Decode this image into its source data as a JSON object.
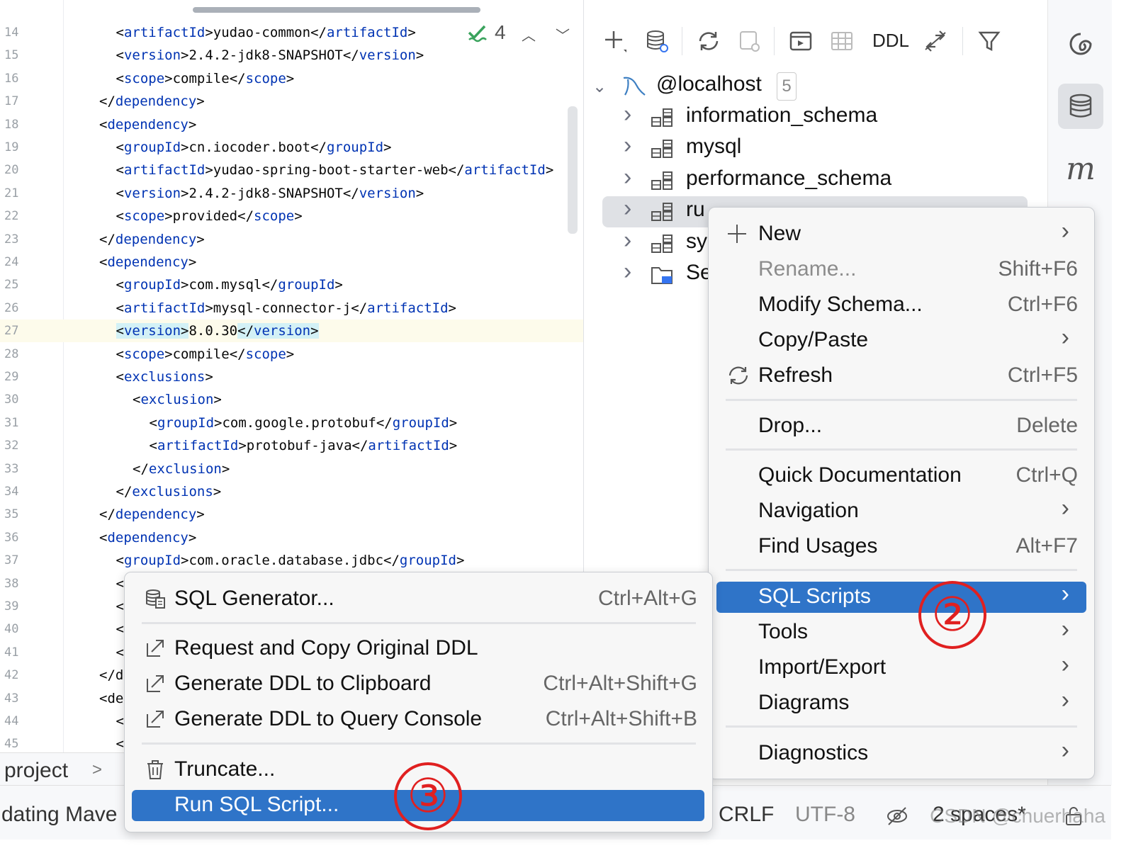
{
  "editor": {
    "inspection_count": "4",
    "lines": [
      {
        "n": "14",
        "indent": 2,
        "open": "artifactId",
        "text": "yudao-common",
        "close": "artifactId"
      },
      {
        "n": "15",
        "indent": 2,
        "open": "version",
        "text": "2.4.2-jdk8-SNAPSHOT",
        "close": "version"
      },
      {
        "n": "16",
        "indent": 2,
        "open": "scope",
        "text": "compile",
        "close": "scope"
      },
      {
        "n": "17",
        "indent": 1,
        "open": "",
        "text": "",
        "close": "dependency"
      },
      {
        "n": "18",
        "indent": 1,
        "open": "dependency",
        "text": "",
        "close": ""
      },
      {
        "n": "19",
        "indent": 2,
        "open": "groupId",
        "text": "cn.iocoder.boot",
        "close": "groupId"
      },
      {
        "n": "20",
        "indent": 2,
        "open": "artifactId",
        "text": "yudao-spring-boot-starter-web",
        "close": "artifactId"
      },
      {
        "n": "21",
        "indent": 2,
        "open": "version",
        "text": "2.4.2-jdk8-SNAPSHOT",
        "close": "version"
      },
      {
        "n": "22",
        "indent": 2,
        "open": "scope",
        "text": "provided",
        "close": "scope"
      },
      {
        "n": "23",
        "indent": 1,
        "open": "",
        "text": "",
        "close": "dependency"
      },
      {
        "n": "24",
        "indent": 1,
        "open": "dependency",
        "text": "",
        "close": ""
      },
      {
        "n": "25",
        "indent": 2,
        "open": "groupId",
        "text": "com.mysql",
        "close": "groupId"
      },
      {
        "n": "26",
        "indent": 2,
        "open": "artifactId",
        "text": "mysql-connector-j",
        "close": "artifactId"
      },
      {
        "n": "27",
        "indent": 2,
        "open": "version",
        "text": "8.0.30",
        "close": "version",
        "highlight": true
      },
      {
        "n": "28",
        "indent": 2,
        "open": "scope",
        "text": "compile",
        "close": "scope"
      },
      {
        "n": "29",
        "indent": 2,
        "open": "exclusions",
        "text": "",
        "close": ""
      },
      {
        "n": "30",
        "indent": 3,
        "open": "exclusion",
        "text": "",
        "close": ""
      },
      {
        "n": "31",
        "indent": 4,
        "open": "groupId",
        "text": "com.google.protobuf",
        "close": "groupId"
      },
      {
        "n": "32",
        "indent": 4,
        "open": "artifactId",
        "text": "protobuf-java",
        "close": "artifactId"
      },
      {
        "n": "33",
        "indent": 3,
        "open": "",
        "text": "",
        "close": "exclusion"
      },
      {
        "n": "34",
        "indent": 2,
        "open": "",
        "text": "",
        "close": "exclusions"
      },
      {
        "n": "35",
        "indent": 1,
        "open": "",
        "text": "",
        "close": "dependency"
      },
      {
        "n": "36",
        "indent": 1,
        "open": "dependency",
        "text": "",
        "close": ""
      },
      {
        "n": "37",
        "indent": 2,
        "open": "groupId",
        "text": "com.oracle.database.jdbc",
        "close": "groupId"
      },
      {
        "n": "38",
        "indent": 2,
        "raw": "<"
      },
      {
        "n": "39",
        "indent": 2,
        "raw": "<"
      },
      {
        "n": "40",
        "indent": 2,
        "raw": "<"
      },
      {
        "n": "41",
        "indent": 2,
        "raw": "<"
      },
      {
        "n": "42",
        "indent": 1,
        "raw": "</d"
      },
      {
        "n": "43",
        "indent": 1,
        "raw": "<de"
      },
      {
        "n": "44",
        "indent": 2,
        "raw": "<"
      },
      {
        "n": "45",
        "indent": 2,
        "raw": "<"
      }
    ]
  },
  "db_toolbar": {
    "ddl_label": "DDL"
  },
  "tree": {
    "root": {
      "label": "@localhost",
      "count": "5"
    },
    "items": [
      {
        "label": "information_schema"
      },
      {
        "label": "mysql"
      },
      {
        "label": "performance_schema"
      },
      {
        "label": "ru"
      },
      {
        "label": "sy"
      },
      {
        "label": "Se"
      }
    ]
  },
  "context_menu": {
    "items": [
      {
        "label": "New",
        "shortcut": "",
        "submenu": true
      },
      {
        "label": "Rename...",
        "shortcut": "Shift+F6",
        "disabled": true
      },
      {
        "label": "Modify Schema...",
        "shortcut": "Ctrl+F6"
      },
      {
        "label": "Copy/Paste",
        "shortcut": "",
        "submenu": true
      },
      {
        "label": "Refresh",
        "shortcut": "Ctrl+F5"
      },
      {
        "label": "Drop...",
        "shortcut": "Delete"
      },
      {
        "label": "Quick Documentation",
        "shortcut": "Ctrl+Q"
      },
      {
        "label": "Navigation",
        "shortcut": "",
        "submenu": true
      },
      {
        "label": "Find Usages",
        "shortcut": "Alt+F7"
      },
      {
        "label": "SQL Scripts",
        "shortcut": "",
        "submenu": true,
        "active": true
      },
      {
        "label": "Tools",
        "shortcut": "",
        "submenu": true
      },
      {
        "label": "Import/Export",
        "shortcut": "",
        "submenu": true
      },
      {
        "label": "Diagrams",
        "shortcut": "",
        "submenu": true
      },
      {
        "label": "Diagnostics",
        "shortcut": "",
        "submenu": true
      }
    ]
  },
  "sql_scripts_menu": {
    "items": [
      {
        "label": "SQL Generator...",
        "shortcut": "Ctrl+Alt+G"
      },
      {
        "label": "Request and Copy Original DDL",
        "shortcut": ""
      },
      {
        "label": "Generate DDL to Clipboard",
        "shortcut": "Ctrl+Alt+Shift+G"
      },
      {
        "label": "Generate DDL to Query Console",
        "shortcut": "Ctrl+Alt+Shift+B"
      },
      {
        "label": "Truncate...",
        "shortcut": ""
      },
      {
        "label": "Run SQL Script...",
        "shortcut": "",
        "active": true
      }
    ]
  },
  "annotations": {
    "step2": "②",
    "step3": "③"
  },
  "statusbar": {
    "project_label": "project",
    "task_text": "dating Mave",
    "line_sep": "CRLF",
    "encoding": "UTF-8",
    "indent": "2 spaces*"
  },
  "watermark": "CSDN @chuerhaha",
  "colors": {
    "accent": "#2f74c8",
    "tag": "#0033b3",
    "annotation": "#e02020"
  }
}
